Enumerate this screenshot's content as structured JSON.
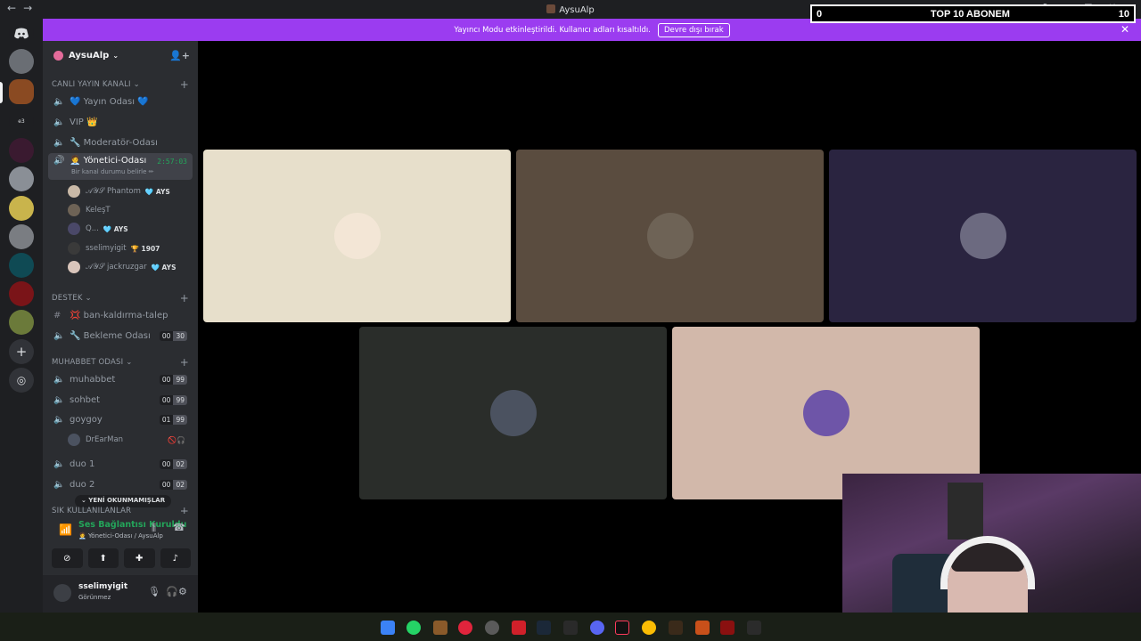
{
  "window": {
    "title": "AysuAlp",
    "nav_back": "←",
    "nav_fwd": "→"
  },
  "overlay": {
    "left": "0",
    "center": "TOP 10 ABONEM",
    "right": "10"
  },
  "banner": {
    "message": "Yayıncı Modu etkinleştirildi. Kullanıcı adları kısaltıldı.",
    "button": "Devre dışı bırak"
  },
  "guild": {
    "name": "AysuAlp"
  },
  "categories": [
    {
      "label": "CANLI YAYIN KANALI"
    },
    {
      "label": "DESTEK"
    },
    {
      "label": "MUHABBET ODASI"
    },
    {
      "label": "SIK KULLANILANLAR"
    }
  ],
  "channels": {
    "yayin": "💙 Yayın Odası 💙",
    "vip": "VIP 👑",
    "moderator": "🔧 Moderatör-Odası",
    "yonetici": "🧑‍💼 Yönetici-Odası",
    "yonetici_timer": "2:57:03",
    "yonetici_status": "Bir kanal durumu belirle ✏",
    "ban": "💢 ban-kaldırma-talep",
    "bekleme": "🔧 Bekleme Odası",
    "bekleme_counts": [
      "00",
      "30"
    ],
    "muhabbet": "muhabbet",
    "muhabbet_counts": [
      "00",
      "99"
    ],
    "sohbet": "sohbet",
    "sohbet_counts": [
      "00",
      "99"
    ],
    "goygoy": "goygoy",
    "goygoy_counts": [
      "01",
      "99"
    ],
    "duo1": "duo 1",
    "duo1_counts": [
      "00",
      "02"
    ],
    "duo2": "duo 2",
    "duo2_counts": [
      "00",
      "02"
    ]
  },
  "members": [
    {
      "name": "𝒜𝒴𝒮 Phantom",
      "tag": "🩵 AYS"
    },
    {
      "name": "KeleşT",
      "tag": ""
    },
    {
      "name": "Q...",
      "tag": "🩵 AYS"
    },
    {
      "name": "sselimyigit",
      "tag": "🏆 1907"
    },
    {
      "name": "𝒜𝒴𝒮 jackruzgar",
      "tag": "🩵 AYS"
    }
  ],
  "goygoy_member": {
    "name": "DrEarMan"
  },
  "new_unread": "⌄ YENİ OKUNMAMIŞLAR",
  "voice": {
    "status": "Ses Bağlantısı Kuruldu",
    "location": "🧑‍💼 Yönetici-Odası / AysuAlp"
  },
  "user": {
    "name": "sselimyigit",
    "status": "Görünmez"
  },
  "colors": {
    "banner": "#9b3cf0",
    "sidebar": "#2b2d31",
    "online_green": "#23a55a",
    "rail": "#1e1f22"
  },
  "tiles": [
    {
      "bg": "#e7dfcb",
      "avatar": "#f3e6d6"
    },
    {
      "bg": "#5a4c3f",
      "avatar": "#6e6356"
    },
    {
      "bg": "#2a2440",
      "avatar": "#6c6a80"
    },
    {
      "bg": "#2a2d2a",
      "avatar": "#4b5260"
    },
    {
      "bg": "#d2b8aa",
      "avatar": "#6e55a8"
    }
  ]
}
